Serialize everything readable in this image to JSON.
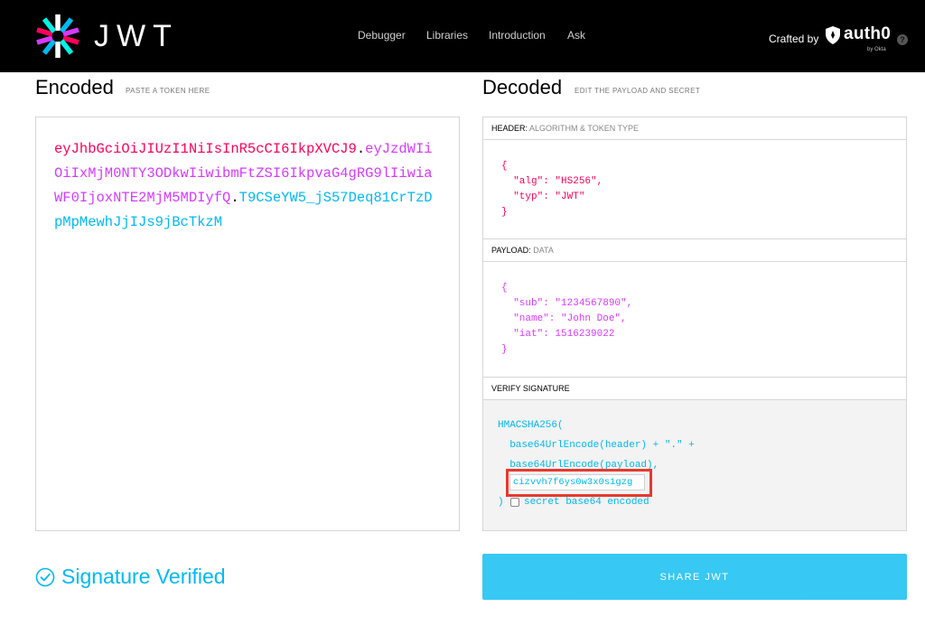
{
  "header": {
    "brand": "JWT",
    "nav": [
      "Debugger",
      "Libraries",
      "Introduction",
      "Ask"
    ],
    "crafted_by": "Crafted by",
    "partner": "auth0",
    "partner_sub": "by Okta",
    "help_label": "?",
    "colors": {
      "background": "#000000",
      "text": "#ffffff"
    }
  },
  "encoded": {
    "title": "Encoded",
    "subtitle": "PASTE A TOKEN HERE",
    "token_header": "eyJhbGciOiJIUzI1NiIsInR5cCI6IkpXVCJ9",
    "token_payload": "eyJzdWIiOiIxMjM0NTY3ODkwIiwibmFtZSI6IkpvaG4gRG9lIiwiaWF0IjoxNTE2MjM5MDIyfQ",
    "token_signature": "T9CSeYW5_jS57Deq81CrTzDpMpMewhJjIJs9jBcTkzM",
    "dot": "."
  },
  "decoded": {
    "title": "Decoded",
    "subtitle": "EDIT THE PAYLOAD AND SECRET",
    "header_section": {
      "label": "HEADER:",
      "sublabel": "ALGORITHM & TOKEN TYPE",
      "lines": [
        "{",
        "  \"alg\": \"HS256\",",
        "  \"typ\": \"JWT\"",
        "}"
      ]
    },
    "payload_section": {
      "label": "PAYLOAD:",
      "sublabel": "DATA",
      "lines": [
        "{",
        "  \"sub\": \"1234567890\",",
        "  \"name\": \"John Doe\",",
        "  \"iat\": 1516239022",
        "}"
      ]
    },
    "signature_section": {
      "label": "VERIFY SIGNATURE",
      "func": "HMACSHA256(",
      "line1": "  base64UrlEncode(header) + \".\" +",
      "line2": "  base64UrlEncode(payload),",
      "secret_value": "cizvvh7f6ys0w3x0s1gzg",
      "close": ")",
      "checkbox_label": "secret base64 encoded"
    }
  },
  "footer": {
    "status": "Signature Verified",
    "share_label": "SHARE JWT"
  },
  "colors": {
    "header_part": "#fb015b",
    "payload_part": "#d63aff",
    "signature_part": "#00b9f1",
    "highlight_border": "#e8392e"
  }
}
